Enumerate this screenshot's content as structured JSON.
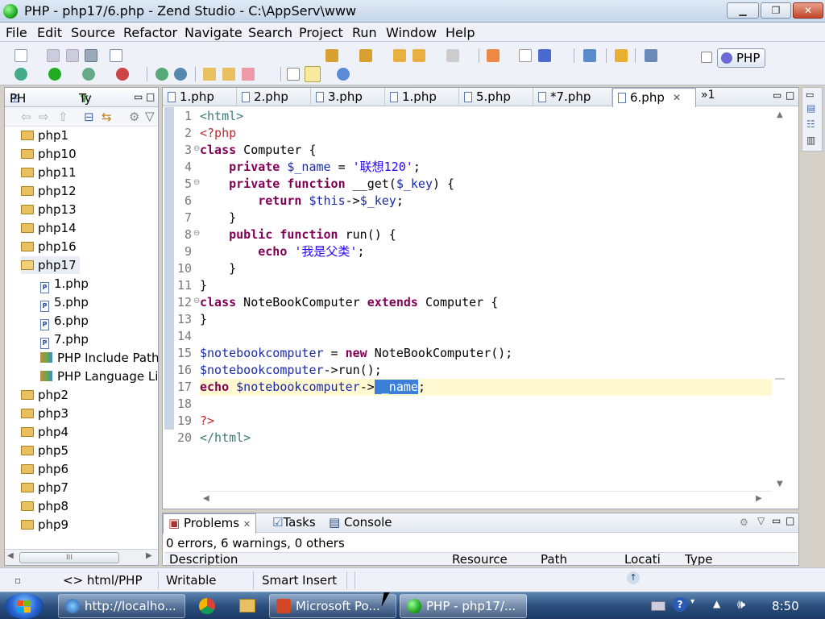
{
  "window": {
    "title": "PHP - php17/6.php - Zend Studio - C:\\AppServ\\www"
  },
  "menu": [
    "File",
    "Edit",
    "Source",
    "Refactor",
    "Navigate",
    "Search",
    "Project",
    "Run",
    "Window",
    "Help"
  ],
  "perspective": {
    "label": "PHP"
  },
  "left_panel": {
    "tabs": [
      "PH",
      "Ty"
    ],
    "tree": [
      {
        "label": "php1",
        "type": "project"
      },
      {
        "label": "php10",
        "type": "project"
      },
      {
        "label": "php11",
        "type": "project"
      },
      {
        "label": "php12",
        "type": "project"
      },
      {
        "label": "php13",
        "type": "project"
      },
      {
        "label": "php14",
        "type": "project"
      },
      {
        "label": "php16",
        "type": "project"
      },
      {
        "label": "php17",
        "type": "project-open"
      },
      {
        "label": "1.php",
        "type": "file"
      },
      {
        "label": "5.php",
        "type": "file"
      },
      {
        "label": "6.php",
        "type": "file"
      },
      {
        "label": "7.php",
        "type": "file"
      },
      {
        "label": "PHP Include Path",
        "type": "library"
      },
      {
        "label": "PHP Language Lib",
        "type": "library"
      },
      {
        "label": "php2",
        "type": "project"
      },
      {
        "label": "php3",
        "type": "project"
      },
      {
        "label": "php4",
        "type": "project"
      },
      {
        "label": "php5",
        "type": "project"
      },
      {
        "label": "php6",
        "type": "project"
      },
      {
        "label": "php7",
        "type": "project"
      },
      {
        "label": "php8",
        "type": "project"
      },
      {
        "label": "php9",
        "type": "project"
      }
    ],
    "scroll_thumb": "III"
  },
  "editor": {
    "tabs": [
      {
        "label": "1.php",
        "active": false
      },
      {
        "label": "2.php",
        "active": false
      },
      {
        "label": "3.php",
        "active": false
      },
      {
        "label": "1.php",
        "active": false
      },
      {
        "label": "5.php",
        "active": false
      },
      {
        "label": "*7.php",
        "active": false
      },
      {
        "label": "6.php",
        "active": true
      }
    ],
    "overflow_label": "»1",
    "line_numbers": [
      "1",
      "2",
      "3",
      "4",
      "5",
      "6",
      "7",
      "8",
      "9",
      "10",
      "11",
      "12",
      "13",
      "14",
      "15",
      "16",
      "17",
      "18",
      "19",
      "20"
    ],
    "fold_markers": {
      "3": "⊖",
      "5": "⊖",
      "8": "⊖",
      "12": "⊖"
    },
    "code": {
      "l1": "<html>",
      "l2": "<?php",
      "l3a": "class",
      "l3b": " Computer {",
      "l4a": "    private",
      "l4b": " $_name",
      "l4c": " = ",
      "l4d": "'联想120'",
      "l4e": ";",
      "l5a": "    private function",
      "l5b": " __get(",
      "l5c": "$_key",
      "l5d": ") {",
      "l6a": "        return",
      "l6b": " $this",
      "l6c": "->",
      "l6d": "$_key",
      "l6e": ";",
      "l7": "    }",
      "l8a": "    public function",
      "l8b": " run() {",
      "l9a": "        echo",
      "l9b": " ",
      "l9c": "'我是父类'",
      "l9d": ";",
      "l10": "    }",
      "l11": "}",
      "l12a": "class",
      "l12b": " NoteBookComputer ",
      "l12c": "extends",
      "l12d": " Computer {",
      "l13": "}",
      "l14": "",
      "l15a": "$notebookcomputer",
      "l15b": " = ",
      "l15c": "new",
      "l15d": " NoteBookComputer();",
      "l16a": "$notebookcomputer",
      "l16b": "->run();",
      "l17a": "echo",
      "l17b": " $notebookcomputer",
      "l17c": "->",
      "l17d": " _name",
      "l17e": ";",
      "l18": "",
      "l19": "?>",
      "l20": "</html>"
    }
  },
  "bottom_panel": {
    "tabs": [
      "Problems",
      "Tasks",
      "Console"
    ],
    "summary": "0 errors, 6 warnings, 0 others",
    "columns": [
      "Description",
      "Resource",
      "Path",
      "Locati",
      "Type"
    ]
  },
  "status_bar": {
    "file_type": "<> html/PHP",
    "mode": "Writable",
    "insert": "Smart Insert"
  },
  "taskbar": {
    "buttons": [
      {
        "label": "http://localho...",
        "icon": "ie-icon"
      },
      {
        "label": "Microsoft Po...",
        "icon": "powerpoint-icon"
      },
      {
        "label": "PHP - php17/...",
        "icon": "zend-icon"
      }
    ],
    "clock": "8:50"
  },
  "colors": {
    "keyword": "#7f0055",
    "tag": "#3a7a7a",
    "php_tag": "#c0282e",
    "variable": "#1a2aa8",
    "string": "#2a00ff",
    "selection": "#3a80d8",
    "current_line": "#fff8d0"
  }
}
